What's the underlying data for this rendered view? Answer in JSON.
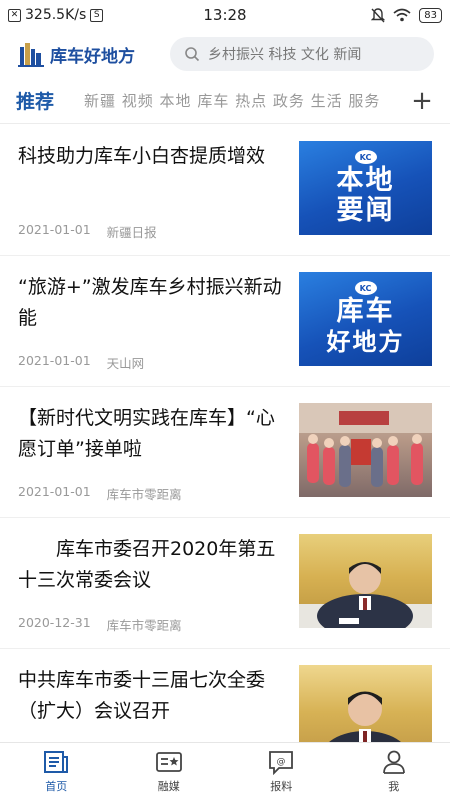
{
  "status_bar": {
    "network_speed": "325.5K/s",
    "time": "13:28",
    "battery": "83"
  },
  "header": {
    "app_name": "库车好地方",
    "search_placeholder": "乡村振兴 科技 文化 新闻"
  },
  "channels": {
    "active": "推荐",
    "others": "新疆 视频 本地 库车 热点 政务 生活 服务"
  },
  "news": [
    {
      "title": "科技助力库车小白杏提质增效",
      "date": "2021-01-01",
      "source": "新疆日报",
      "thumb": "local-news",
      "thumb_text": [
        "本地",
        "要闻"
      ]
    },
    {
      "title": "“旅游+”激发库车乡村振兴新动能",
      "date": "2021-01-01",
      "source": "天山网",
      "thumb": "kuche-good-place",
      "thumb_text": [
        "库车",
        "好地方"
      ]
    },
    {
      "title": "【新时代文明实践在库车】“心愿订单”接单啦",
      "date": "2021-01-01",
      "source": "库车市零距离",
      "thumb": "photo",
      "thumb_text": []
    },
    {
      "title": "　　库车市委召开2020年第五十三次常委会议",
      "date": "2020-12-31",
      "source": "库车市零距离",
      "thumb": "photo",
      "thumb_text": []
    },
    {
      "title": "中共库车市委十三届七次全委（扩大）会议召开",
      "date": "",
      "source": "",
      "thumb": "photo",
      "thumb_text": []
    }
  ],
  "bottom_nav": [
    {
      "label": "首页",
      "icon": "news-icon",
      "active": true
    },
    {
      "label": "融媒",
      "icon": "media-card-icon",
      "active": false
    },
    {
      "label": "报料",
      "icon": "report-chat-icon",
      "active": false
    },
    {
      "label": "我",
      "icon": "profile-icon",
      "active": false
    }
  ],
  "colors": {
    "accent": "#1e5aa8",
    "thumb_blue": "#1652b8"
  }
}
